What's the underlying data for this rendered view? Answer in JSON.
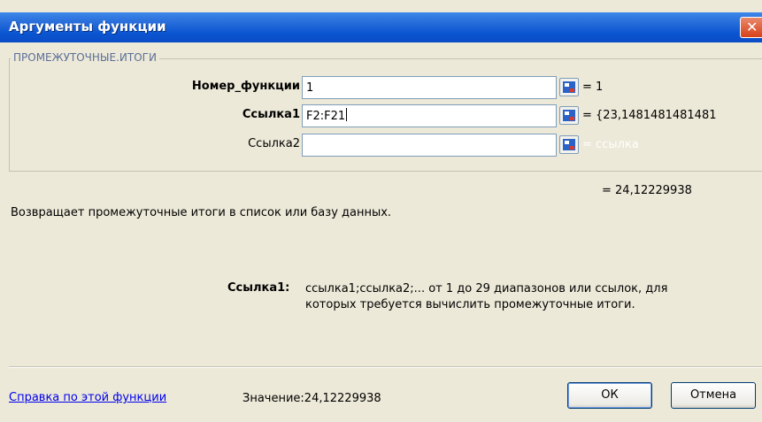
{
  "window": {
    "title": "Аргументы функции",
    "close_glyph": "✕"
  },
  "function_group": {
    "name": "ПРОМЕЖУТОЧНЫЕ.ИТОГИ"
  },
  "arguments": [
    {
      "label": "Номер_функции",
      "input_value": "1",
      "result": "= 1"
    },
    {
      "label": "Ссылка1",
      "input_value": "F2:F21",
      "result": "= {23,1481481481481"
    },
    {
      "label": "Ссылка2",
      "input_value": "",
      "result": "= ссылка"
    }
  ],
  "formula_result": "= 24,12229938",
  "description": "Возвращает промежуточные итоги в список или базу данных.",
  "parameter_help": {
    "name": "Ссылка1:",
    "text": "ссылка1;ссылка2;... от 1 до 29 диапазонов или ссылок, для которых требуется вычислить промежуточные итоги."
  },
  "footer": {
    "help_link": "Справка по этой функции",
    "value_text": "Значение:24,12229938",
    "ok_label": "ОК",
    "cancel_label": "Отмена"
  },
  "colors": {
    "title_bar": "#0b55d1",
    "dialog_bg": "#ece9d8",
    "link": "#0000ee",
    "group_legend": "#5d6f99"
  }
}
